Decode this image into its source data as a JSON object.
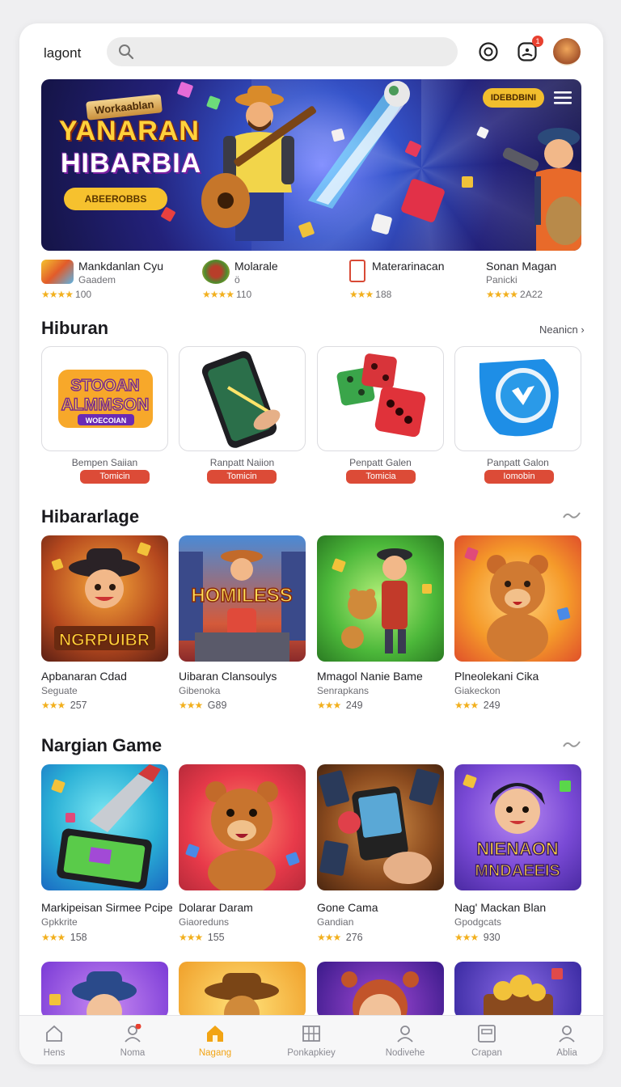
{
  "header": {
    "brand": "lagont",
    "search_placeholder": "",
    "notification_count": "1",
    "icons": [
      "search-icon",
      "compass-icon",
      "bell-icon",
      "avatar"
    ]
  },
  "hero": {
    "tagline": "Workaablan",
    "title_line1": "YANARAN",
    "title_line2": "HIBARBIA",
    "cta": "ABEEROBBS",
    "badge": "IDEBDBINI"
  },
  "featured": [
    {
      "name": "Mankdanlan Cyu",
      "sub": "Gaadem",
      "rating": "100"
    },
    {
      "name": "Molarale",
      "sub": "ö",
      "rating": "110"
    },
    {
      "name": "Materarinacan",
      "sub": "",
      "rating": "188"
    },
    {
      "name": "Sonan Magan",
      "sub": "Panicki",
      "rating": "2A22"
    }
  ],
  "section1": {
    "title": "Hiburan",
    "link": "Neanicn",
    "cards": [
      {
        "art_line1": "STOOAN",
        "art_line2": "ALMMSON",
        "art_line3": "WOECOIAN",
        "label": "Bempen Saiian",
        "pill": "Tomicin"
      },
      {
        "label": "Ranpatt Naiion",
        "pill": "Tomicin"
      },
      {
        "label": "Penpatt Galen",
        "pill": "Tomicia"
      },
      {
        "label": "Panpatt Galon",
        "pill": "Iomobin"
      }
    ]
  },
  "section2": {
    "title": "Hibararlage",
    "games": [
      {
        "art_text": "NGRPUIBR",
        "name": "Apbanaran Cdad",
        "sub": "Seguate",
        "rating": "257"
      },
      {
        "art_text": "HOMILESS",
        "name": "Uibaran Clansoulys",
        "sub": "Gibenoka",
        "rating": "G89"
      },
      {
        "name": "Mmagol Nanie Bame",
        "sub": "Senrapkans",
        "rating": "249"
      },
      {
        "name": "Plneolekani Cika",
        "sub": "Giakeckon",
        "rating": "249"
      }
    ]
  },
  "section3": {
    "title": "Nargian Game",
    "games": [
      {
        "name": "Markipeisan Sirmee Pcipe",
        "sub": "Gpkkrite",
        "rating": "158"
      },
      {
        "name": "Dolarar Daram",
        "sub": "Giaoreduns",
        "rating": "155"
      },
      {
        "name": "Gone Cama",
        "sub": "Gandian",
        "rating": "276"
      },
      {
        "art_line1": "NIENAON",
        "art_line2": "MNDAEEIS",
        "name": "Nag' Mackan Blan",
        "sub": "Gpodgcats",
        "rating": "930"
      }
    ]
  },
  "nav": [
    {
      "label": "Hens",
      "icon": "home-icon"
    },
    {
      "label": "Noma",
      "icon": "user-icon"
    },
    {
      "label": "Nagang",
      "icon": "home-icon",
      "active": true
    },
    {
      "label": "Ponkapkiey",
      "icon": "grid-icon"
    },
    {
      "label": "Nodivehe",
      "icon": "user-icon"
    },
    {
      "label": "Crapan",
      "icon": "tablet-icon"
    },
    {
      "label": "Ablia",
      "icon": "profile-icon"
    }
  ],
  "colors": {
    "accent": "#f2a414",
    "pill": "#dc4b37",
    "star": "#f2b01e",
    "badge": "#e8402f"
  }
}
